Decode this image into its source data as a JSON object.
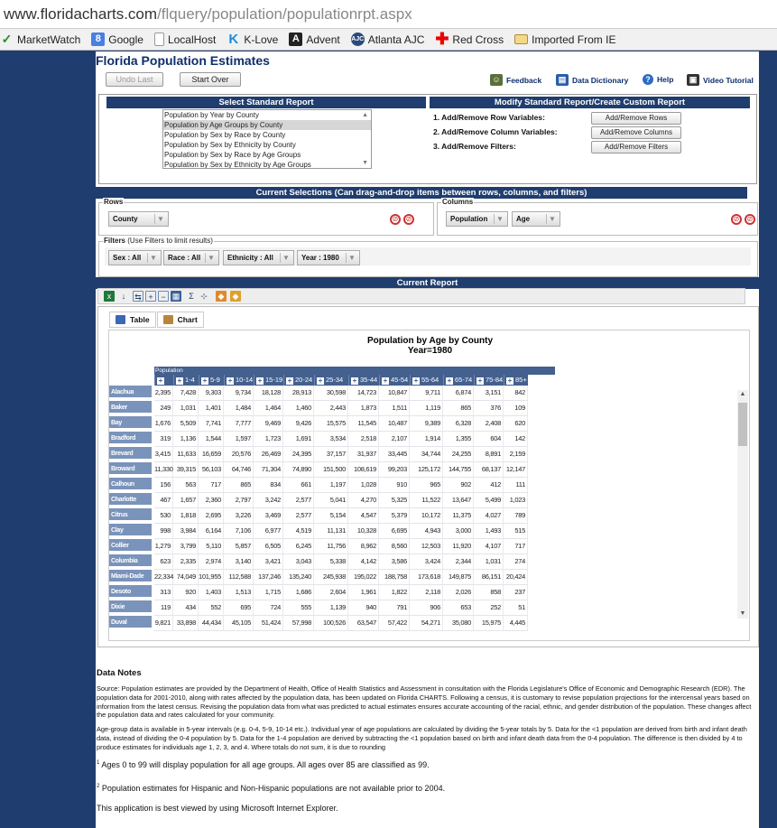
{
  "browser": {
    "url_host": "www.floridacharts.com",
    "url_path": "/flquery/population/populationrpt.aspx",
    "bookmarks": [
      {
        "label": "MarketWatch",
        "icon": "checkmark-icon"
      },
      {
        "label": "Google",
        "icon": "google-icon"
      },
      {
        "label": "LocalHost",
        "icon": "page-icon"
      },
      {
        "label": "K-Love",
        "icon": "k-icon"
      },
      {
        "label": "Advent",
        "icon": "a-icon"
      },
      {
        "label": "Atlanta AJC",
        "icon": "ajc-icon"
      },
      {
        "label": "Red Cross",
        "icon": "redcross-icon"
      },
      {
        "label": "Imported From IE",
        "icon": "folder-icon"
      }
    ]
  },
  "page": {
    "title": "Florida Population Estimates",
    "undo_label": "Undo Last",
    "start_over_label": "Start Over",
    "links": {
      "feedback": "Feedback",
      "dictionary": "Data Dictionary",
      "help": "Help",
      "video": "Video Tutorial"
    }
  },
  "select_report": {
    "header": "Select Standard Report",
    "options": [
      "Population by Year by County",
      "Population by Age Groups by County",
      "Population by Sex by Race by County",
      "Population by Sex by Ethnicity by County",
      "Population by Sex by Race by Age Groups",
      "Population by Sex by Ethnicity by Age Groups"
    ],
    "selected_index": 1
  },
  "modify_report": {
    "header": "Modify Standard Report/Create Custom Report",
    "rows_label": "1. Add/Remove Row Variables:",
    "cols_label": "2. Add/Remove Column Variables:",
    "filters_label": "3. Add/Remove Filters:",
    "rows_button": "Add/Remove Rows",
    "cols_button": "Add/Remove Columns",
    "filters_button": "Add/Remove Filters"
  },
  "current_selections": {
    "header": "Current Selections (Can drag-and-drop items between rows, columns, and filters)",
    "rows_legend": "Rows",
    "rows": [
      "County"
    ],
    "columns_legend": "Columns",
    "columns": [
      "Population",
      "Age"
    ],
    "filters_legend": "Filters",
    "filters_hint": "(Use Filters to limit results)",
    "filters": [
      "Sex : All",
      "Race : All",
      "Ethnicity : All",
      "Year : 1980"
    ]
  },
  "report": {
    "header": "Current Report",
    "tab_table": "Table",
    "tab_chart": "Chart",
    "title_line1": "Population by Age by County",
    "title_line2": "Year=1980",
    "band_label": "Population",
    "age_groups": [
      "<1",
      "1-4",
      "5-9",
      "10-14",
      "15-19",
      "20-24",
      "25-34",
      "35-44",
      "45-54",
      "55-64",
      "65-74",
      "75-84",
      "85+"
    ],
    "rows": [
      {
        "county": "Alachua",
        "values": [
          "2,395",
          "7,428",
          "9,303",
          "9,734",
          "18,128",
          "28,913",
          "30,598",
          "14,723",
          "10,847",
          "9,711",
          "6,874",
          "3,151",
          "842"
        ]
      },
      {
        "county": "Baker",
        "values": [
          "249",
          "1,031",
          "1,401",
          "1,484",
          "1,464",
          "1,460",
          "2,443",
          "1,873",
          "1,511",
          "1,119",
          "865",
          "376",
          "109"
        ]
      },
      {
        "county": "Bay",
        "values": [
          "1,676",
          "5,509",
          "7,741",
          "7,777",
          "9,469",
          "9,426",
          "15,575",
          "11,545",
          "10,487",
          "9,389",
          "6,328",
          "2,408",
          "620"
        ]
      },
      {
        "county": "Bradford",
        "values": [
          "319",
          "1,136",
          "1,544",
          "1,597",
          "1,723",
          "1,691",
          "3,534",
          "2,518",
          "2,107",
          "1,914",
          "1,355",
          "604",
          "142"
        ]
      },
      {
        "county": "Brevard",
        "values": [
          "3,415",
          "11,633",
          "16,659",
          "20,576",
          "26,469",
          "24,395",
          "37,157",
          "31,937",
          "33,445",
          "34,744",
          "24,255",
          "8,891",
          "2,159"
        ]
      },
      {
        "county": "Broward",
        "values": [
          "11,330",
          "39,315",
          "56,103",
          "64,746",
          "71,304",
          "74,890",
          "151,500",
          "108,619",
          "99,203",
          "125,172",
          "144,755",
          "68,137",
          "12,147"
        ]
      },
      {
        "county": "Calhoun",
        "values": [
          "156",
          "563",
          "717",
          "865",
          "834",
          "661",
          "1,197",
          "1,028",
          "910",
          "965",
          "902",
          "412",
          "111"
        ]
      },
      {
        "county": "Charlotte",
        "values": [
          "467",
          "1,657",
          "2,360",
          "2,797",
          "3,242",
          "2,577",
          "5,041",
          "4,270",
          "5,325",
          "11,522",
          "13,647",
          "5,499",
          "1,023"
        ]
      },
      {
        "county": "Citrus",
        "values": [
          "530",
          "1,818",
          "2,695",
          "3,226",
          "3,469",
          "2,577",
          "5,154",
          "4,547",
          "5,379",
          "10,172",
          "11,375",
          "4,027",
          "789"
        ]
      },
      {
        "county": "Clay",
        "values": [
          "998",
          "3,984",
          "6,164",
          "7,106",
          "6,977",
          "4,519",
          "11,131",
          "10,328",
          "6,695",
          "4,943",
          "3,000",
          "1,493",
          "515"
        ]
      },
      {
        "county": "Collier",
        "values": [
          "1,279",
          "3,799",
          "5,110",
          "5,857",
          "6,505",
          "6,245",
          "11,756",
          "8,962",
          "8,560",
          "12,503",
          "11,920",
          "4,107",
          "717"
        ]
      },
      {
        "county": "Columbia",
        "values": [
          "623",
          "2,335",
          "2,974",
          "3,140",
          "3,421",
          "3,043",
          "5,338",
          "4,142",
          "3,586",
          "3,424",
          "2,344",
          "1,031",
          "274"
        ]
      },
      {
        "county": "Miami-Dade",
        "values": [
          "22,334",
          "74,049",
          "101,955",
          "112,588",
          "137,246",
          "135,240",
          "245,938",
          "195,022",
          "188,758",
          "173,618",
          "149,875",
          "86,151",
          "20,424"
        ]
      },
      {
        "county": "Desoto",
        "values": [
          "313",
          "920",
          "1,403",
          "1,513",
          "1,715",
          "1,686",
          "2,604",
          "1,961",
          "1,822",
          "2,118",
          "2,026",
          "858",
          "237"
        ]
      },
      {
        "county": "Dixie",
        "values": [
          "119",
          "434",
          "552",
          "695",
          "724",
          "555",
          "1,139",
          "940",
          "791",
          "906",
          "653",
          "252",
          "51"
        ]
      },
      {
        "county": "Duval",
        "values": [
          "9,821",
          "33,898",
          "44,434",
          "45,105",
          "51,424",
          "57,998",
          "100,526",
          "63,547",
          "57,422",
          "54,271",
          "35,080",
          "15,975",
          "4,445"
        ]
      }
    ]
  },
  "notes": {
    "heading": "Data Notes",
    "p1": "Source: Population estimates are provided by the Department of Health, Office of Health Statistics and Assessment in consultation with the Florida Legislature's Office of Economic and Demographic Research (EDR). The population data for 2001-2010, along with rates affected by the population data, has been updated on Florida CHARTS. Following a census, it is customary to revise population projections for the intercensal years based on information from the latest census. Revising the population data from what was predicted to actual estimates ensures accurate accounting of the racial, ethnic, and gender distribution of the population. These changes affect the population data and rates calculated for your community.",
    "p2": "Age-group data is available in 5-year intervals (e.g. 0-4, 5-9, 10-14 etc.). Individual year of age populations are calculated by dividing the 5-year totals by 5. Data for the <1 population are derived from birth and infant death data, instead of dividing the 0-4 population by 5. Data for the 1-4 population are derived by subtracting the <1 population based on birth and infant death data from the 0-4 population. The difference is then divided by 4 to produce estimates for individuals age 1, 2, 3, and 4. Where totals do not sum, it is due to rounding",
    "fn1_mark": "1",
    "fn1": "Ages 0 to 99 will display population for all age groups. All ages over 85 are classified as 99.",
    "fn2_mark": "2",
    "fn2": "Population estimates for Hispanic and Non-Hispanic populations are not available prior to 2004.",
    "best_viewed": "This application is best viewed by using Microsoft Internet Explorer."
  }
}
